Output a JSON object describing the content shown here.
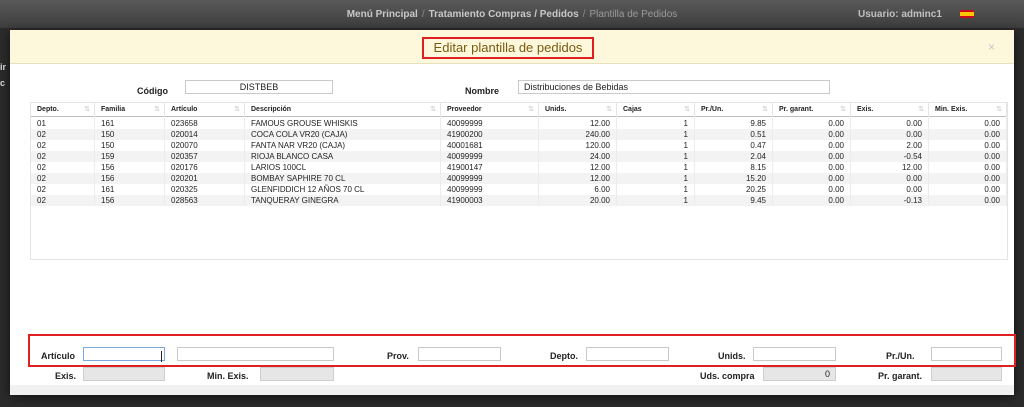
{
  "topbar": {
    "menu": "Menú Principal",
    "section": "Tratamiento Compras / Pedidos",
    "current": "Plantilla de Pedidos",
    "separator": "/",
    "user_label": "Usuario:",
    "user_name": "adminc1"
  },
  "side": {
    "stub1": "ir",
    "stub2": "c"
  },
  "modal": {
    "title": "Editar plantilla de pedidos",
    "close": "×"
  },
  "header_form": {
    "codigo_label": "Código",
    "codigo_value": "DISTBEB",
    "nombre_label": "Nombre",
    "nombre_value": "Distribuciones de Bebidas"
  },
  "table": {
    "sort_glyph": "⇅",
    "columns": [
      "Depto.",
      "Familia",
      "Artículo",
      "Descripción",
      "Proveedor",
      "Unids.",
      "Cajas",
      "Pr./Un.",
      "Pr. garant.",
      "Exis.",
      "Min. Exis."
    ],
    "rows": [
      [
        "01",
        "161",
        "023658",
        "FAMOUS GROUSE WHISKIS",
        "40099999",
        "12.00",
        "1",
        "9.85",
        "0.00",
        "0.00",
        "0.00"
      ],
      [
        "02",
        "150",
        "020014",
        "COCA COLA VR20 (CAJA)",
        "41900200",
        "240.00",
        "1",
        "0.51",
        "0.00",
        "0.00",
        "0.00"
      ],
      [
        "02",
        "150",
        "020070",
        "FANTA NAR VR20 (CAJA)",
        "40001681",
        "120.00",
        "1",
        "0.47",
        "0.00",
        "2.00",
        "0.00"
      ],
      [
        "02",
        "159",
        "020357",
        "RIOJA BLANCO CASA",
        "40099999",
        "24.00",
        "1",
        "2.04",
        "0.00",
        "-0.54",
        "0.00"
      ],
      [
        "02",
        "156",
        "020176",
        "LARIOS 100CL",
        "41900147",
        "12.00",
        "1",
        "8.15",
        "0.00",
        "12.00",
        "0.00"
      ],
      [
        "02",
        "156",
        "020201",
        "BOMBAY SAPHIRE 70 CL",
        "40099999",
        "12.00",
        "1",
        "15.20",
        "0.00",
        "0.00",
        "0.00"
      ],
      [
        "02",
        "161",
        "020325",
        "GLENFIDDICH 12 AÑOS 70 CL",
        "40099999",
        "6.00",
        "1",
        "20.25",
        "0.00",
        "0.00",
        "0.00"
      ],
      [
        "02",
        "156",
        "028563",
        "TANQUERAY GINEGRA",
        "41900003",
        "20.00",
        "1",
        "9.45",
        "0.00",
        "-0.13",
        "0.00"
      ]
    ]
  },
  "entry_form": {
    "articulo_label": "Artículo",
    "articulo_value": "",
    "descripcion_value": "",
    "prov_label": "Prov.",
    "prov_value": "",
    "depto_label": "Depto.",
    "depto_value": "",
    "unids_label": "Unids.",
    "unids_value": "",
    "prun_label": "Pr./Un.",
    "prun_value": "",
    "exis_label": "Exis.",
    "exis_value": "",
    "minexis_label": "Min. Exis.",
    "minexis_value": "",
    "udscompra_label": "Uds. compra",
    "udscompra_value": "0",
    "prgarant_label": "Pr. garant.",
    "prgarant_value": ""
  }
}
